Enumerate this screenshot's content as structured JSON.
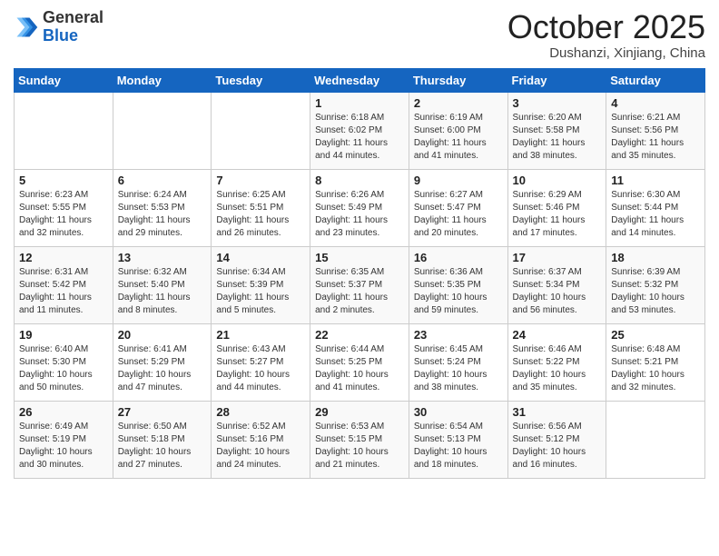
{
  "header": {
    "logo_general": "General",
    "logo_blue": "Blue",
    "month_title": "October 2025",
    "subtitle": "Dushanzi, Xinjiang, China"
  },
  "weekdays": [
    "Sunday",
    "Monday",
    "Tuesday",
    "Wednesday",
    "Thursday",
    "Friday",
    "Saturday"
  ],
  "weeks": [
    [
      {
        "day": "",
        "sunrise": "",
        "sunset": "",
        "daylight": ""
      },
      {
        "day": "",
        "sunrise": "",
        "sunset": "",
        "daylight": ""
      },
      {
        "day": "",
        "sunrise": "",
        "sunset": "",
        "daylight": ""
      },
      {
        "day": "1",
        "sunrise": "Sunrise: 6:18 AM",
        "sunset": "Sunset: 6:02 PM",
        "daylight": "Daylight: 11 hours and 44 minutes."
      },
      {
        "day": "2",
        "sunrise": "Sunrise: 6:19 AM",
        "sunset": "Sunset: 6:00 PM",
        "daylight": "Daylight: 11 hours and 41 minutes."
      },
      {
        "day": "3",
        "sunrise": "Sunrise: 6:20 AM",
        "sunset": "Sunset: 5:58 PM",
        "daylight": "Daylight: 11 hours and 38 minutes."
      },
      {
        "day": "4",
        "sunrise": "Sunrise: 6:21 AM",
        "sunset": "Sunset: 5:56 PM",
        "daylight": "Daylight: 11 hours and 35 minutes."
      }
    ],
    [
      {
        "day": "5",
        "sunrise": "Sunrise: 6:23 AM",
        "sunset": "Sunset: 5:55 PM",
        "daylight": "Daylight: 11 hours and 32 minutes."
      },
      {
        "day": "6",
        "sunrise": "Sunrise: 6:24 AM",
        "sunset": "Sunset: 5:53 PM",
        "daylight": "Daylight: 11 hours and 29 minutes."
      },
      {
        "day": "7",
        "sunrise": "Sunrise: 6:25 AM",
        "sunset": "Sunset: 5:51 PM",
        "daylight": "Daylight: 11 hours and 26 minutes."
      },
      {
        "day": "8",
        "sunrise": "Sunrise: 6:26 AM",
        "sunset": "Sunset: 5:49 PM",
        "daylight": "Daylight: 11 hours and 23 minutes."
      },
      {
        "day": "9",
        "sunrise": "Sunrise: 6:27 AM",
        "sunset": "Sunset: 5:47 PM",
        "daylight": "Daylight: 11 hours and 20 minutes."
      },
      {
        "day": "10",
        "sunrise": "Sunrise: 6:29 AM",
        "sunset": "Sunset: 5:46 PM",
        "daylight": "Daylight: 11 hours and 17 minutes."
      },
      {
        "day": "11",
        "sunrise": "Sunrise: 6:30 AM",
        "sunset": "Sunset: 5:44 PM",
        "daylight": "Daylight: 11 hours and 14 minutes."
      }
    ],
    [
      {
        "day": "12",
        "sunrise": "Sunrise: 6:31 AM",
        "sunset": "Sunset: 5:42 PM",
        "daylight": "Daylight: 11 hours and 11 minutes."
      },
      {
        "day": "13",
        "sunrise": "Sunrise: 6:32 AM",
        "sunset": "Sunset: 5:40 PM",
        "daylight": "Daylight: 11 hours and 8 minutes."
      },
      {
        "day": "14",
        "sunrise": "Sunrise: 6:34 AM",
        "sunset": "Sunset: 5:39 PM",
        "daylight": "Daylight: 11 hours and 5 minutes."
      },
      {
        "day": "15",
        "sunrise": "Sunrise: 6:35 AM",
        "sunset": "Sunset: 5:37 PM",
        "daylight": "Daylight: 11 hours and 2 minutes."
      },
      {
        "day": "16",
        "sunrise": "Sunrise: 6:36 AM",
        "sunset": "Sunset: 5:35 PM",
        "daylight": "Daylight: 10 hours and 59 minutes."
      },
      {
        "day": "17",
        "sunrise": "Sunrise: 6:37 AM",
        "sunset": "Sunset: 5:34 PM",
        "daylight": "Daylight: 10 hours and 56 minutes."
      },
      {
        "day": "18",
        "sunrise": "Sunrise: 6:39 AM",
        "sunset": "Sunset: 5:32 PM",
        "daylight": "Daylight: 10 hours and 53 minutes."
      }
    ],
    [
      {
        "day": "19",
        "sunrise": "Sunrise: 6:40 AM",
        "sunset": "Sunset: 5:30 PM",
        "daylight": "Daylight: 10 hours and 50 minutes."
      },
      {
        "day": "20",
        "sunrise": "Sunrise: 6:41 AM",
        "sunset": "Sunset: 5:29 PM",
        "daylight": "Daylight: 10 hours and 47 minutes."
      },
      {
        "day": "21",
        "sunrise": "Sunrise: 6:43 AM",
        "sunset": "Sunset: 5:27 PM",
        "daylight": "Daylight: 10 hours and 44 minutes."
      },
      {
        "day": "22",
        "sunrise": "Sunrise: 6:44 AM",
        "sunset": "Sunset: 5:25 PM",
        "daylight": "Daylight: 10 hours and 41 minutes."
      },
      {
        "day": "23",
        "sunrise": "Sunrise: 6:45 AM",
        "sunset": "Sunset: 5:24 PM",
        "daylight": "Daylight: 10 hours and 38 minutes."
      },
      {
        "day": "24",
        "sunrise": "Sunrise: 6:46 AM",
        "sunset": "Sunset: 5:22 PM",
        "daylight": "Daylight: 10 hours and 35 minutes."
      },
      {
        "day": "25",
        "sunrise": "Sunrise: 6:48 AM",
        "sunset": "Sunset: 5:21 PM",
        "daylight": "Daylight: 10 hours and 32 minutes."
      }
    ],
    [
      {
        "day": "26",
        "sunrise": "Sunrise: 6:49 AM",
        "sunset": "Sunset: 5:19 PM",
        "daylight": "Daylight: 10 hours and 30 minutes."
      },
      {
        "day": "27",
        "sunrise": "Sunrise: 6:50 AM",
        "sunset": "Sunset: 5:18 PM",
        "daylight": "Daylight: 10 hours and 27 minutes."
      },
      {
        "day": "28",
        "sunrise": "Sunrise: 6:52 AM",
        "sunset": "Sunset: 5:16 PM",
        "daylight": "Daylight: 10 hours and 24 minutes."
      },
      {
        "day": "29",
        "sunrise": "Sunrise: 6:53 AM",
        "sunset": "Sunset: 5:15 PM",
        "daylight": "Daylight: 10 hours and 21 minutes."
      },
      {
        "day": "30",
        "sunrise": "Sunrise: 6:54 AM",
        "sunset": "Sunset: 5:13 PM",
        "daylight": "Daylight: 10 hours and 18 minutes."
      },
      {
        "day": "31",
        "sunrise": "Sunrise: 6:56 AM",
        "sunset": "Sunset: 5:12 PM",
        "daylight": "Daylight: 10 hours and 16 minutes."
      },
      {
        "day": "",
        "sunrise": "",
        "sunset": "",
        "daylight": ""
      }
    ]
  ]
}
